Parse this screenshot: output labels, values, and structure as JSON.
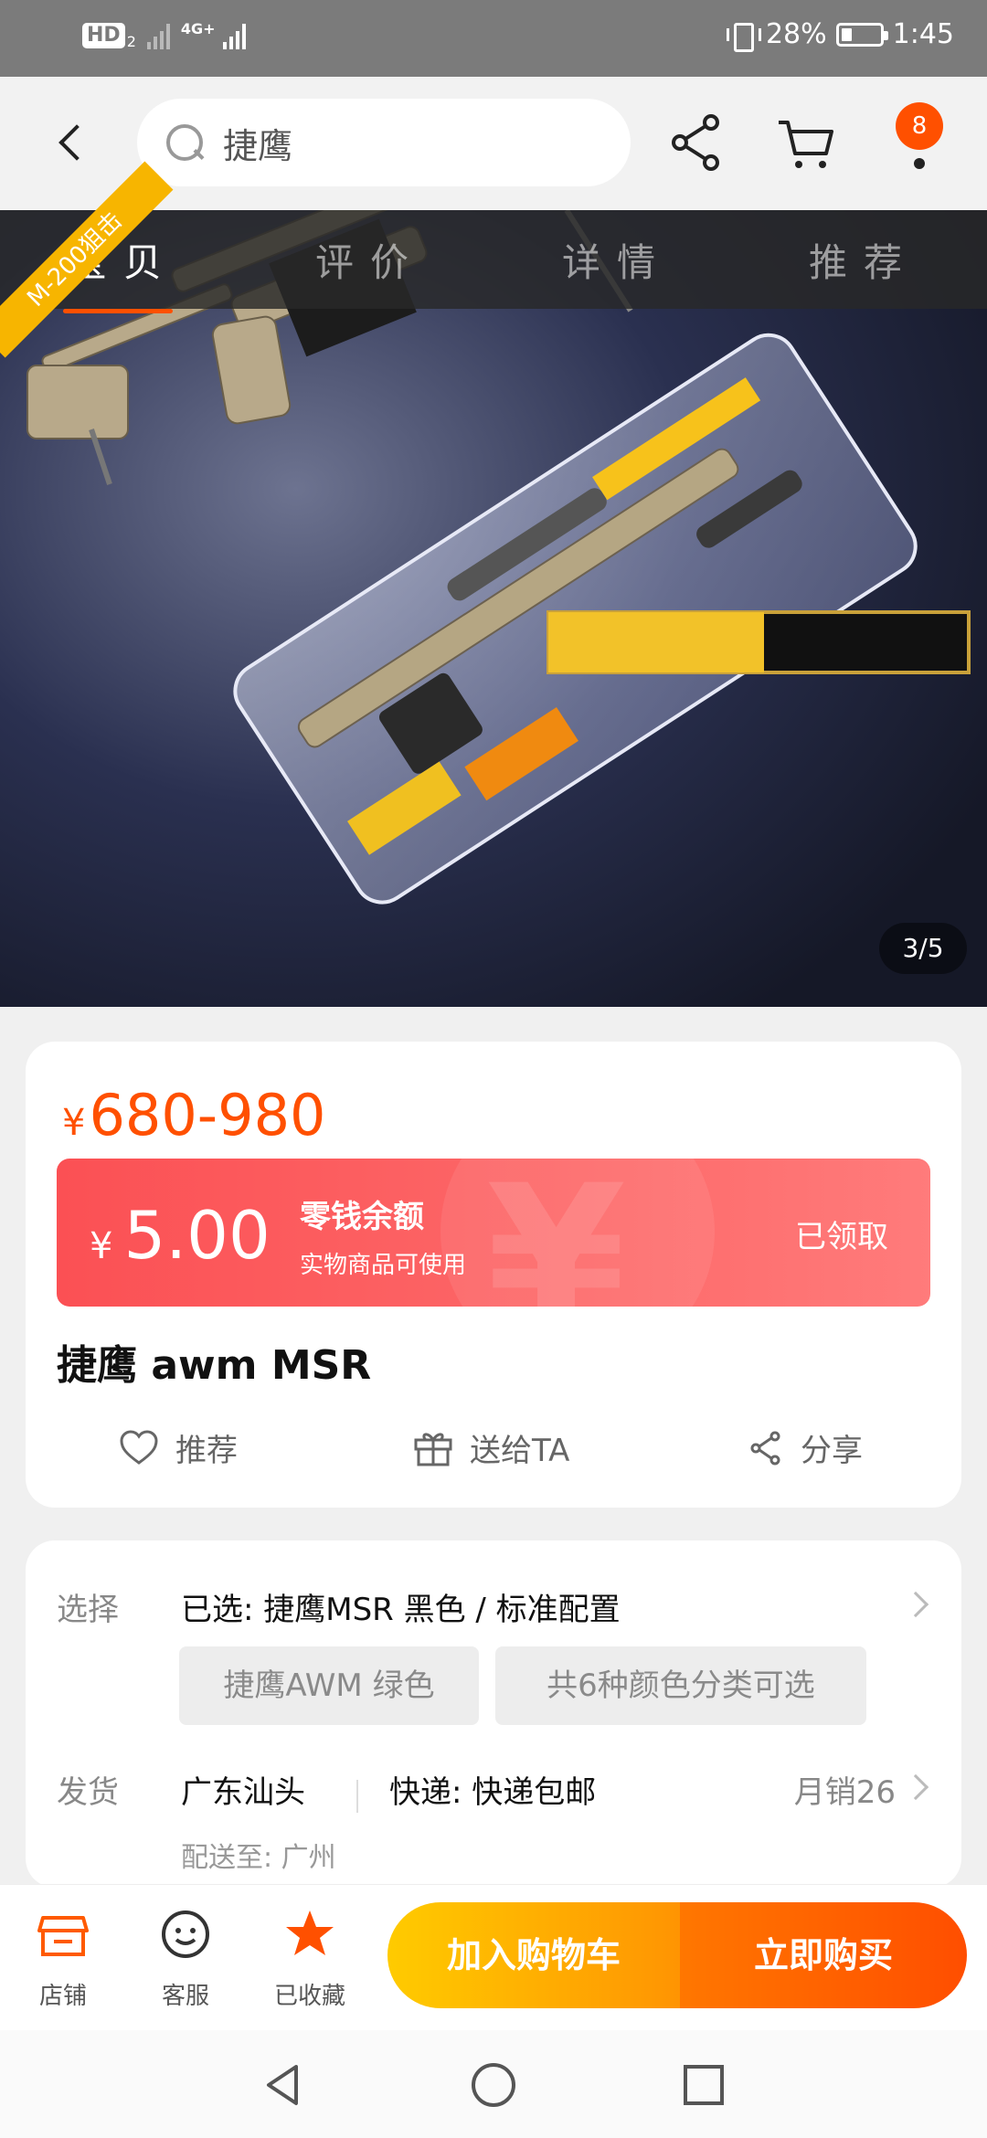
{
  "status_bar": {
    "hd": "HD",
    "hd_sub": "2",
    "network": "4G+",
    "battery_percent": "28%",
    "battery_level": 0.28,
    "time": "1:45"
  },
  "nav": {
    "search_text": "捷鹰",
    "cart_badge": "8"
  },
  "tabs": [
    "宝贝",
    "评价",
    "详情",
    "推荐"
  ],
  "image": {
    "corner_label": "M-200狙击",
    "counter": "3/5"
  },
  "price": {
    "currency": "¥",
    "range": "680-980"
  },
  "coupon": {
    "currency": "¥",
    "amount": "5.00",
    "title": "零钱余额",
    "subtitle": "实物商品可使用",
    "button": "已领取"
  },
  "product": {
    "title": "捷鹰 awm MSR"
  },
  "actions": {
    "recommend": "推荐",
    "gift": "送给TA",
    "share": "分享"
  },
  "options": {
    "select_label": "选择",
    "selected_value": "已选: 捷鹰MSR 黑色 / 标准配置",
    "chips": [
      "捷鹰AWM 绿色",
      "共6种颜色分类可选"
    ],
    "ship_label": "发货",
    "ship_from": "广东汕头",
    "express": "快递: 快递包邮",
    "monthly_sales": "月销26",
    "deliver_to": "配送至: 广州"
  },
  "bottom_bar": {
    "store": "店铺",
    "service": "客服",
    "favorited": "已收藏",
    "add_to_cart": "加入购物车",
    "buy_now": "立即购买"
  },
  "colors": {
    "accent": "#ff5000",
    "coupon": "#fb5054",
    "cart_button": "#ffb300",
    "buy_button": "#ff5a00"
  }
}
